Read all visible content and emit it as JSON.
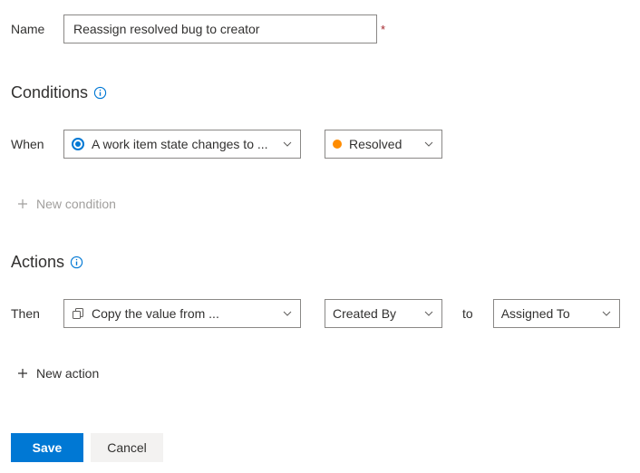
{
  "name": {
    "label": "Name",
    "value": "Reassign resolved bug to creator"
  },
  "conditions": {
    "heading": "Conditions",
    "when_label": "When",
    "trigger_label": "A work item state changes to ...",
    "state_label": "Resolved",
    "state_color": "#ff8c00",
    "new_condition_label": "New condition"
  },
  "actions": {
    "heading": "Actions",
    "then_label": "Then",
    "action_label": "Copy the value from ...",
    "from_field": "Created By",
    "to_label": "to",
    "to_field": "Assigned To",
    "new_action_label": "New action"
  },
  "footer": {
    "save": "Save",
    "cancel": "Cancel"
  }
}
